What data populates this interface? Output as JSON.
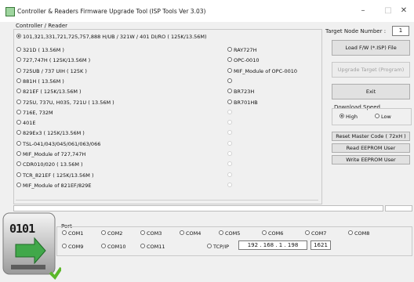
{
  "window": {
    "title": "Controller & Readers Firmware Upgrade Tool  (ISP Tools Ver 3.03)",
    "minimize": "–",
    "maximize": "□",
    "close": "✕"
  },
  "controller_group": {
    "label": "Controller / Reader",
    "selected_option": "101,321,331,721,725,757,888 H/UB / 321W / 401 DI/RO  ( 125K/13.56M)",
    "left_column": [
      "321D         (         13.56M )",
      "727,747H   ( 125K/13.56M )",
      "725UB / 737 UIH    ( 125K          )",
      "881H         (         13.56M )",
      "821EF       ( 125K/13.56M )",
      "725U, 737U, H035, 721U  (        13.56M )",
      "716E, 732M",
      "401E",
      "829Ex3        ( 125K/13.56M )",
      "TSL-041/043/045/061/063/066",
      "MIF_Module of 727,747H",
      "CDR010/020   (        13.56M )",
      "TCR_821EF        ( 125K/13.56M )",
      "MIF_Module of 821EF/829E"
    ],
    "right_column": [
      "RAY727H",
      "OPC-0010",
      "MIF_Module of OPC-0010",
      "",
      "BR723H",
      "BR701HB"
    ]
  },
  "target_node": {
    "label": "Target Node Number :",
    "value": "1"
  },
  "buttons": {
    "load_fw": "Load F/W (*.ISP) File",
    "upgrade": "Upgrade Target (Program)",
    "exit": "Exit",
    "reset_master": "Reset Master Code  ( 72xH )",
    "read_eeprom": "Read EEPROM User",
    "write_eeprom": "Write EEPROM User"
  },
  "download_speed": {
    "label": "Download Speed",
    "high": "High",
    "low": "Low",
    "selected": "High"
  },
  "port_group": {
    "label": "Port",
    "ports_row1": [
      "COM1",
      "COM2",
      "COM3",
      "COM4",
      "COM5",
      "COM6",
      "COM7",
      "COM8"
    ],
    "ports_row2": [
      "COM9",
      "COM10",
      "COM11"
    ],
    "tcpip_label": "TCP/IP",
    "ip": "192 . 168 .   1 . 198",
    "tcp_port": "1621"
  },
  "overlay_icon": {
    "text": "0101",
    "icon": "binary-download-icon"
  },
  "colors": {
    "disabled_text": "#a0a0a0",
    "check_green": "#5cb82a"
  }
}
